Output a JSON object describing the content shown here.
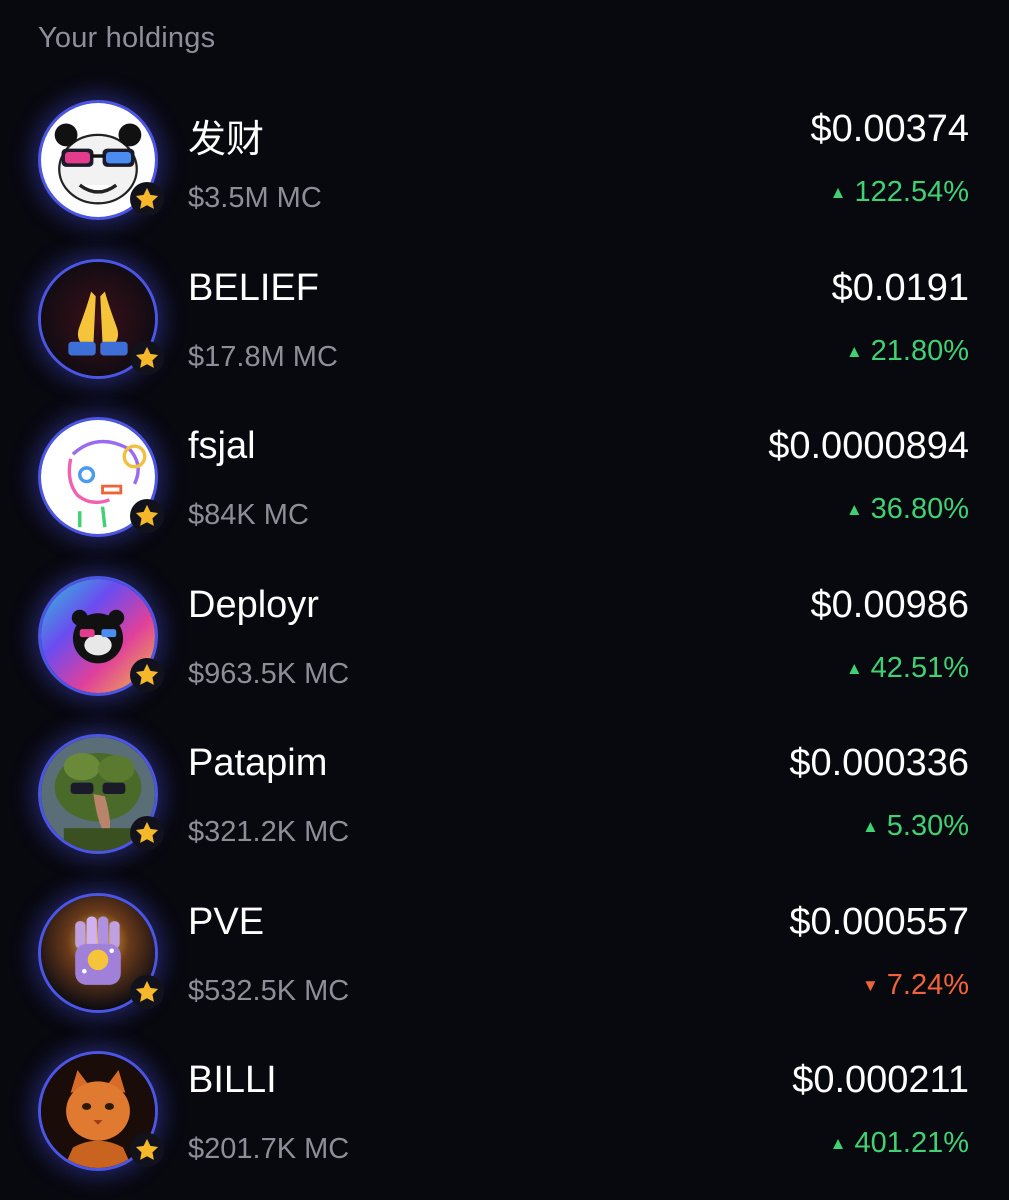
{
  "section": {
    "title": "Your holdings"
  },
  "holdings": [
    {
      "name": "发财",
      "market_cap": "$3.5M MC",
      "price": "$0.00374",
      "change": "122.54%",
      "direction": "up",
      "icon": "panda-sunglasses-icon"
    },
    {
      "name": "BELIEF",
      "market_cap": "$17.8M MC",
      "price": "$0.0191",
      "change": "21.80%",
      "direction": "up",
      "icon": "praying-hands-icon"
    },
    {
      "name": "fsjal",
      "market_cap": "$84K MC",
      "price": "$0.0000894",
      "change": "36.80%",
      "direction": "up",
      "icon": "rainbow-doodle-face-icon"
    },
    {
      "name": "Deployr",
      "market_cap": "$963.5K MC",
      "price": "$0.00986",
      "change": "42.51%",
      "direction": "up",
      "icon": "bear-sunglasses-icon"
    },
    {
      "name": "Patapim",
      "market_cap": "$321.2K MC",
      "price": "$0.000336",
      "change": "5.30%",
      "direction": "up",
      "icon": "tree-creature-icon"
    },
    {
      "name": "PVE",
      "market_cap": "$532.5K MC",
      "price": "$0.000557",
      "change": "7.24%",
      "direction": "down",
      "icon": "glitter-fist-icon"
    },
    {
      "name": "BILLI",
      "market_cap": "$201.7K MC",
      "price": "$0.000211",
      "change": "401.21%",
      "direction": "up",
      "icon": "orange-cat-icon"
    }
  ],
  "indicators": {
    "up_arrow": "▲",
    "down_arrow": "▼"
  },
  "colors": {
    "background": "#08080f",
    "up": "#3fd173",
    "down": "#f06238",
    "avatar_ring": "#4b55e6",
    "star": "#f5b82a"
  }
}
